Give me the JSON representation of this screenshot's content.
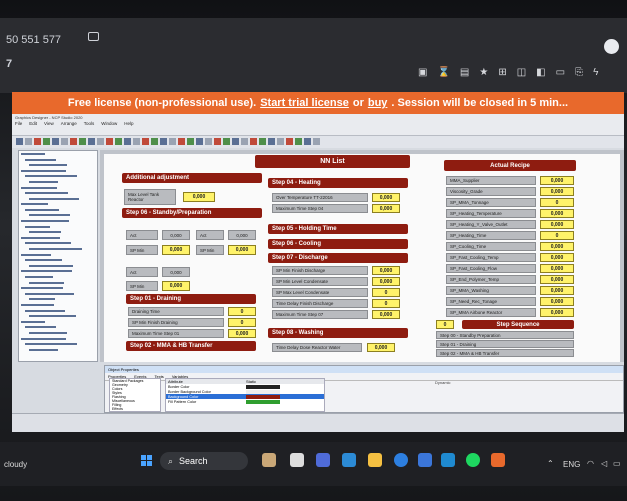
{
  "browser": {
    "tab_title": "50 551 577",
    "tab_number": "7"
  },
  "banner": {
    "lead": "Free license (non-professional use).",
    "link1": "Start trial license",
    "or": "or",
    "link2": "buy",
    "tail": ". Session will be closed in 5 min..."
  },
  "app": {
    "title": "Graphics Designer - NCP Studio 2020",
    "menu": [
      "File",
      "Edit",
      "View",
      "Arrange",
      "Tools",
      "Window",
      "Help"
    ],
    "nn_title": "NN List",
    "actual_recipe_title": "Actual Recipe",
    "left_column": {
      "additional_adjustment": "Additional adjustment",
      "max_level_tank": "Max Level Tank Reactor",
      "max_level_value": "0,000",
      "step06": "Step 06 - Standby/Preparation",
      "step01": "Step 01 - Draining",
      "step02": "Step 02 - MMA & HB Transfer",
      "draining_row1": "Draining Time",
      "draining_row2": "SP Min Finish Draining",
      "draining_row3": "Maximum Time Step 01",
      "draining_values": [
        "0",
        "0",
        "0,000"
      ],
      "act": "Act",
      "sp_min": "SP Min",
      "act_values": [
        "0,000",
        "0,000",
        "0,000"
      ],
      "spmin_values": [
        "0,000",
        "0,000",
        "0,000"
      ]
    },
    "middle_column": {
      "step04": "Step 04 - Heating",
      "heating_row1": "Over Temperature TT-22016",
      "heating_row2": "Maximum Time Step 04",
      "heating_values": [
        "0,000",
        "0,000"
      ],
      "step05": "Step 05 - Holding Time",
      "step06": "Step 06 - Cooling",
      "step07": "Step 07 - Discharge",
      "discharge_rows": [
        "SP Min Finish Discharge",
        "SP Min Level Condensate",
        "SP Max Level Condensate",
        "Time Delay Finish Discharge",
        "Maximum Time Step 07"
      ],
      "discharge_values": [
        "0,000",
        "0,000",
        "0",
        "0",
        "0,000"
      ],
      "step08": "Step 08 - Washing",
      "washing_row": "Time Delay Dose Reactor Water",
      "washing_value": "0,000"
    },
    "recipe": {
      "rows": [
        "MMA_Supplier",
        "Viscosity_Grade",
        "SP_MMA_Tonnage",
        "SP_Heating_Temperature",
        "SP_Heating_Y_Valve_Outlet",
        "SP_Heating_Time",
        "SP_Cooling_Time",
        "SP_Fast_Cooling_Temp",
        "SP_Fast_Cooling_Flow",
        "SP_End_Polymer_Temp",
        "SP_MMA_Washing",
        "SP_Need_Rec_Tonage",
        "SP_MMA Airbone Reactor"
      ],
      "values": [
        "0,000",
        "0,000",
        "0",
        "0,000",
        "0,000",
        "0",
        "0,000",
        "0,000",
        "0,000",
        "0,000",
        "0,000",
        "0,000",
        "0,000"
      ],
      "step_sequence_num": "0",
      "step_sequence": "Step Sequence",
      "seq_rows": [
        "Step 00 - Standby Preparation",
        "Step 01 - Draining",
        "Step 02 - MMA & HB Transfer"
      ]
    },
    "properties": {
      "title": "Object Properties",
      "tabs": [
        "Properties",
        "Events",
        "Texts",
        "Variables"
      ],
      "items": [
        "Standard Packages",
        "Geometry",
        "Colors",
        "Styles",
        "Flashing",
        "Miscellaneous",
        "Filling",
        "Effects"
      ],
      "attr_header": "Attribute",
      "static_header": "Static",
      "dynamic_header": "Dynamic",
      "attrs": [
        "Border Color",
        "Border Background Color",
        "Background Color",
        "Fill Pattern Color"
      ]
    }
  },
  "taskbar": {
    "search": "Search",
    "weather": "cloudy",
    "lang": "ENG"
  },
  "colors": {
    "accent": "#8e1c10",
    "banner": "#e8692c",
    "value_yellow": "#fff36a"
  }
}
